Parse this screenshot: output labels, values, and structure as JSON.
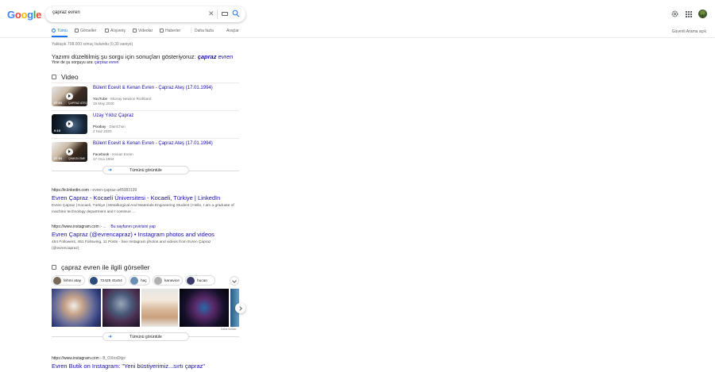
{
  "header": {
    "logo_letters": [
      {
        "ch": "G",
        "color": "#4285f4"
      },
      {
        "ch": "o",
        "color": "#ea4335"
      },
      {
        "ch": "o",
        "color": "#fbbc05"
      },
      {
        "ch": "g",
        "color": "#4285f4"
      },
      {
        "ch": "l",
        "color": "#34a853"
      },
      {
        "ch": "e",
        "color": "#ea4335"
      }
    ],
    "query": "çapraz evren",
    "clear_icon": "close-icon",
    "keyboard_icon": "keyboard-icon",
    "search_icon": "search-icon",
    "settings_icon": "gear-icon",
    "apps_icon": "apps-grid-icon"
  },
  "tabs": [
    {
      "label": "Tümü",
      "active": true
    },
    {
      "label": "Görseller",
      "active": false
    },
    {
      "label": "Alışveriş",
      "active": false
    },
    {
      "label": "Videolar",
      "active": false
    },
    {
      "label": "Haberler",
      "active": false
    },
    {
      "label": "Daha fazla",
      "active": false
    }
  ],
  "tools_label": "Araçlar",
  "safe_search_label": "Güvenli Arama açık",
  "result_stats": "Yaklaşık 708.000 sonuç bulundu (0,30 saniye)",
  "spelling": {
    "prefix": "Yazımı düzeltilmiş şu sorgu için sonuçları gösteriyoruz:",
    "corrected_bold": "çapraz",
    "corrected_rest": " evren",
    "instead_prefix": "Yine de şu sorguyu ara:",
    "instead_link": "çarpraz evren"
  },
  "videos": {
    "title": "Video",
    "items": [
      {
        "title": "Bülent Ecevit & Kenan Evren - Çapraz Ateş (17.01.1994)",
        "source": "YouTube",
        "author": "Murray Newton Rothbard",
        "date": "15 May 2020",
        "duration": "27:01",
        "watermark": "ÇAPRAZ ATEŞ"
      },
      {
        "title": "Uzay Yıldız Çapraz",
        "source": "Pixabay",
        "author": "DianChun",
        "date": "2 Haz 2020",
        "duration": "0:10",
        "watermark": ""
      },
      {
        "title": "Bülent Ecevit & Kenan Evren - Çapraz Ateş (17.01.1994)",
        "source": "Facebook",
        "author": "Kenan Evren",
        "date": "17 Oca 1994",
        "duration": "27:01",
        "watermark": "ÇİNKIZLOME"
      }
    ],
    "more_label": "Tümünü görüntüle"
  },
  "results": [
    {
      "cite_domain": "https://tr.linkedin.com",
      "cite_path": " › evren-çapraz-a45083199",
      "translate": "",
      "title": "Evren Çapraz - Kocaeli Üniversitesi - Kocaeli, Türkiye | LinkedIn",
      "snippet": "Evren Çapraz | Kocaeli, Türkiye | Metallurgical And Materials Engineering Student | Hello, I am a graduate of machine technology department and I continue ..."
    },
    {
      "cite_domain": "https://www.instagram.com",
      "cite_path": " › ...",
      "translate": "Bu sayfanın çevirisini yap",
      "title": "Evren Çapraz (@evrencapraz) • Instagram photos and videos",
      "snippet": "464 Followers, 451 Following, 11 Posts - See Instagram photos and videos from Evren Çapraz (@evrencapraz)"
    }
  ],
  "images": {
    "title": "çapraz evren ile ilgili görseller",
    "chips": [
      {
        "label": "fehmi atay",
        "color": "#7a6a5a"
      },
      {
        "label": "72425 41x54",
        "color": "#2c4a7a"
      },
      {
        "label": "haç",
        "color": "#6a8fb4"
      },
      {
        "label": "kanavice",
        "color": "#b0b0b0"
      },
      {
        "label": "hucan",
        "color": "#3a3a6a"
      }
    ],
    "credit": "Daha fazlası",
    "more_label": "Tümünü görüntüle"
  },
  "last_result": {
    "cite_domain": "https://www.instagram.com",
    "cite_path": " › B_OXnxDtjcr",
    "title": "Evren Butik on Instagram: \"Yeni büstiyerimiz...sırtı çapraz\""
  }
}
